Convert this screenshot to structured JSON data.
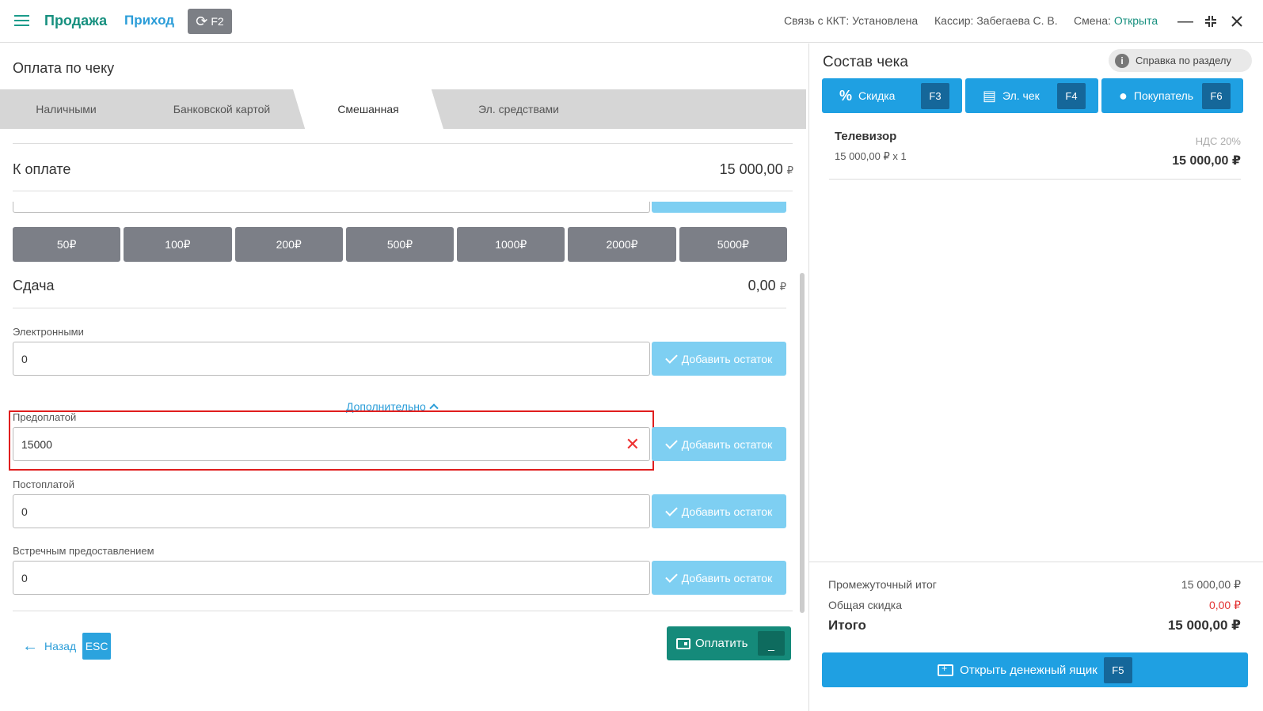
{
  "topbar": {
    "nav_sale": "Продажа",
    "nav_income": "Приход",
    "sync_key": "F2",
    "kkt_status": "Связь с ККТ: Установлена",
    "cashier": "Кассир: Забегаева С. В.",
    "shift_label": "Смена:",
    "shift_value": "Открыта"
  },
  "payment": {
    "title": "Оплата по чеку",
    "tabs": [
      "Наличными",
      "Банковской картой",
      "Смешанная",
      "Эл. средствами"
    ],
    "active_tab": "Смешанная",
    "due_label": "К оплате",
    "due_value": "15 000,00",
    "currency": "₽",
    "denominations": [
      "50₽",
      "100₽",
      "200₽",
      "500₽",
      "1000₽",
      "2000₽",
      "5000₽"
    ],
    "change_label": "Сдача",
    "change_value": "0,00",
    "add_remainder": "Добавить остаток",
    "more_link": "Дополнительно",
    "fields": [
      {
        "label": "Электронными",
        "value": "0"
      },
      {
        "label": "Предоплатой",
        "value": "15000"
      },
      {
        "label": "Постоплатой",
        "value": "0"
      },
      {
        "label": "Встречным предоставлением",
        "value": "0"
      }
    ],
    "back_label": "Назад",
    "back_key": "ESC",
    "pay_label": "Оплатить",
    "pay_key": "_"
  },
  "receipt": {
    "title": "Состав чека",
    "help": "Справка по разделу",
    "buttons": [
      {
        "label": "Скидка",
        "key": "F3"
      },
      {
        "label": "Эл. чек",
        "key": "F4"
      },
      {
        "label": "Покупатель",
        "key": "F6"
      }
    ],
    "item": {
      "name": "Телевизор",
      "qty": "15 000,00 ₽ x 1",
      "vat": "НДС 20%",
      "sum": "15 000,00 ₽"
    },
    "subtotal_label": "Промежуточный итог",
    "subtotal_value": "15 000,00 ₽",
    "discount_label": "Общая скидка",
    "discount_value": "0,00 ₽",
    "total_label": "Итого",
    "total_value": "15 000,00 ₽",
    "drawer_label": "Открыть денежный ящик",
    "drawer_key": "F5"
  },
  "colors": {
    "green": "#17907f",
    "blue": "#1fa0e2",
    "light_blue": "#7ecff2",
    "red": "#e33333"
  }
}
